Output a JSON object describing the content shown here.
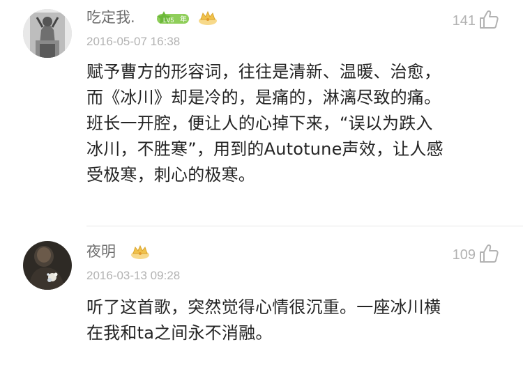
{
  "comments": [
    {
      "username": "吃定我.",
      "level_badge": "LV5",
      "level_suffix": "年",
      "timestamp": "2016-05-07 16:38",
      "likes": "141",
      "lines": [
        "赋予曹方的形容词，往往是清新、温暖、治愈，",
        "而《冰川》却是冷的，是痛的，淋漓尽致的痛。",
        "班长一开腔，便让人的心掉下来，“误以为跌入",
        "冰川，不胜寒”，用到的Autotune声效，让人感",
        "受极寒，刺心的极寒。"
      ],
      "badges": [
        "level-badge-icon",
        "crown-icon"
      ]
    },
    {
      "username": "夜明",
      "timestamp": "2016-03-13 09:28",
      "likes": "109",
      "lines": [
        "听了这首歌，突然觉得心情很沉重。一座冰川横",
        "在我和ta之间永不消融。"
      ],
      "badges": [
        "crown-icon"
      ]
    }
  ],
  "colors": {
    "username": "#6e6e6e",
    "meta": "#b2b2b2",
    "text": "#242424",
    "badge_green": "#8fce5a",
    "badge_gold": "#f0c14b"
  },
  "icons": [
    "thumbs-up-icon",
    "crown-icon",
    "level-badge-icon"
  ]
}
